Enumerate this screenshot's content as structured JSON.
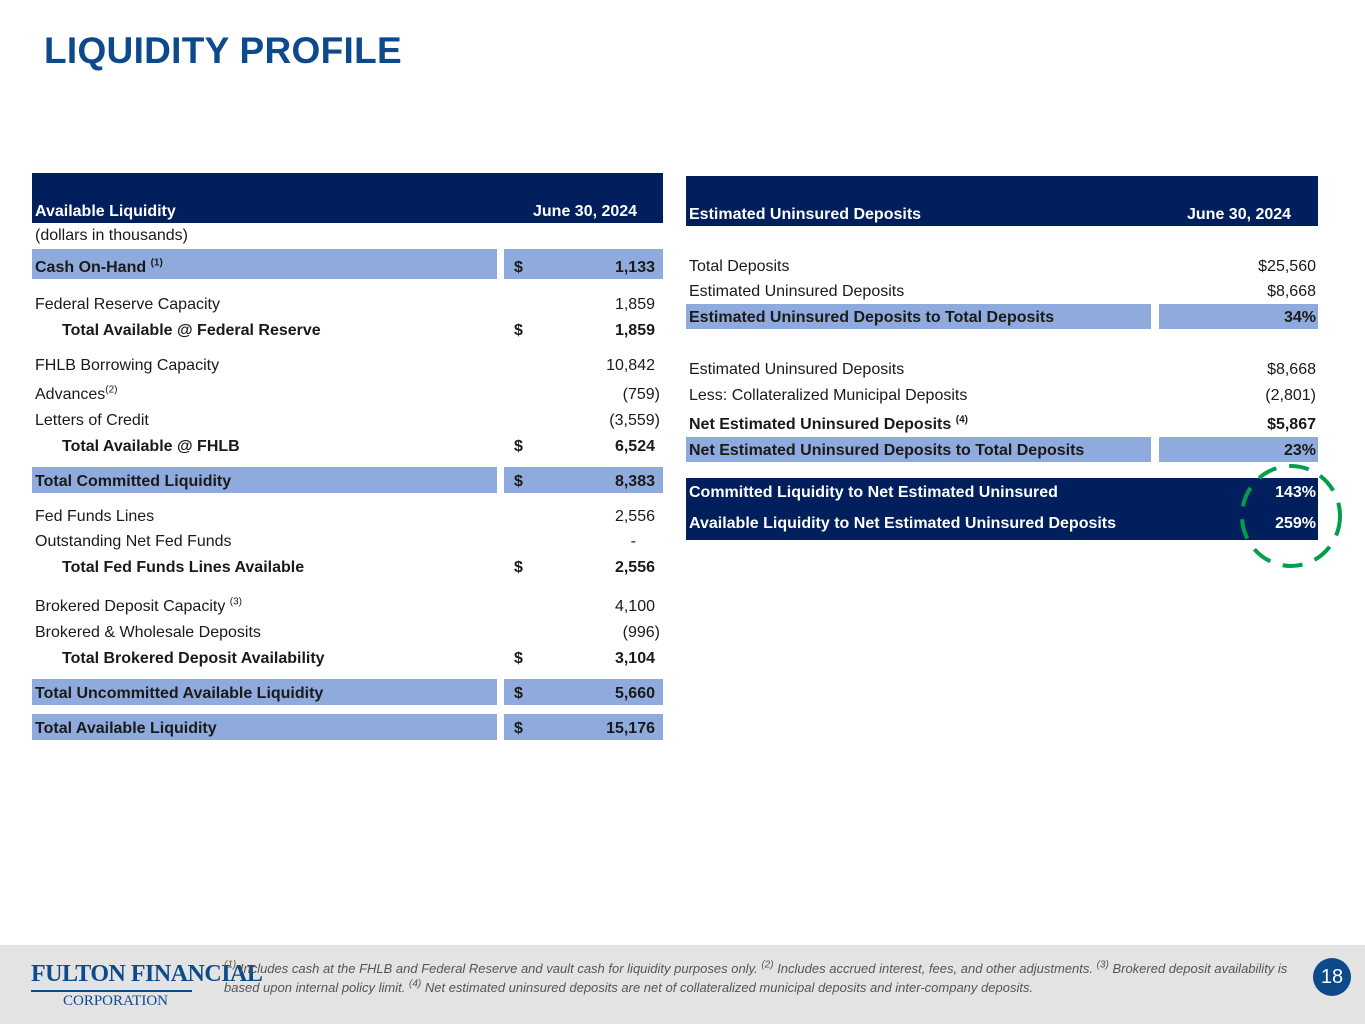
{
  "title": "LIQUIDITY PROFILE",
  "colors": {
    "header_navy": "#001f5c",
    "band_blue": "#8faadc",
    "title_blue": "#0d4a8c",
    "highlight_green": "#00a04a"
  },
  "left_table": {
    "header_label": "Available Liquidity",
    "header_date": "June 30, 2024",
    "subtitle": "(dollars in thousands)",
    "cash_on_hand": {
      "label": "Cash On-Hand",
      "sup": "(1)",
      "dollar": "$",
      "value": "1,133"
    },
    "fed_reserve_capacity": {
      "label": "Federal Reserve Capacity",
      "value": "1,859"
    },
    "total_fed_reserve": {
      "label": "Total Available @ Federal Reserve",
      "dollar": "$",
      "value": "1,859"
    },
    "fhlb_capacity": {
      "label": "FHLB Borrowing Capacity",
      "value": "10,842"
    },
    "advances": {
      "label": "Advances",
      "sup": "(2)",
      "value": "(759)"
    },
    "letters_of_credit": {
      "label": "Letters of Credit",
      "value": "(3,559)"
    },
    "total_fhlb": {
      "label": "Total Available @ FHLB",
      "dollar": "$",
      "value": "6,524"
    },
    "total_committed": {
      "label": "Total Committed Liquidity",
      "dollar": "$",
      "value": "8,383"
    },
    "fed_funds_lines": {
      "label": "Fed Funds Lines",
      "value": "2,556"
    },
    "outstanding_fed_funds": {
      "label": "Outstanding Net Fed Funds",
      "value": "-"
    },
    "total_fed_funds": {
      "label": "Total Fed Funds Lines Available",
      "dollar": "$",
      "value": "2,556"
    },
    "brokered_capacity": {
      "label": "Brokered Deposit Capacity",
      "sup": "(3)",
      "value": "4,100"
    },
    "brokered_wholesale": {
      "label": "Brokered & Wholesale Deposits",
      "value": "(996)"
    },
    "total_brokered": {
      "label": "Total Brokered Deposit Availability",
      "dollar": "$",
      "value": "3,104"
    },
    "total_uncommitted": {
      "label": "Total Uncommitted Available Liquidity",
      "dollar": "$",
      "value": "5,660"
    },
    "total_available": {
      "label": "Total Available Liquidity",
      "dollar": "$",
      "value": "15,176"
    }
  },
  "right_table": {
    "header_label": "Estimated Uninsured Deposits",
    "header_date": "June 30, 2024",
    "total_deposits": {
      "label": "Total Deposits",
      "value": "$25,560"
    },
    "est_uninsured": {
      "label": "Estimated Uninsured Deposits",
      "value": "$8,668"
    },
    "est_uninsured_ratio": {
      "label": "Estimated Uninsured Deposits to Total Deposits",
      "value": "34%"
    },
    "est_uninsured_2": {
      "label": "Estimated Uninsured Deposits",
      "value": "$8,668"
    },
    "less_collateralized": {
      "label": "Less: Collateralized Municipal Deposits",
      "value": "(2,801)"
    },
    "net_est_uninsured": {
      "label": "Net Estimated Uninsured Deposits",
      "sup": "(4)",
      "value": "$5,867"
    },
    "net_ratio": {
      "label": "Net Estimated Uninsured Deposits to Total Deposits",
      "value": "23%"
    },
    "committed_ratio": {
      "label": "Committed Liquidity to Net Estimated Uninsured",
      "value": "143%"
    },
    "available_ratio": {
      "label": "Available Liquidity to Net Estimated Uninsured Deposits",
      "value": "259%"
    }
  },
  "footer": {
    "logo_line1": "Fulton Financial",
    "logo_line2": "Corporation",
    "note1_sup": "(1)",
    "note1": " Includes cash at the FHLB and Federal Reserve and vault cash for liquidity purposes only. ",
    "note2_sup": "(2)",
    "note2": " Includes accrued interest, fees, and other adjustments. ",
    "note3_sup": "(3)",
    "note3": " Brokered deposit availability is based upon internal policy limit. ",
    "note4_sup": "(4)",
    "note4": " Net estimated uninsured deposits are net of collateralized municipal deposits and inter-company deposits.",
    "page_number": "18"
  }
}
